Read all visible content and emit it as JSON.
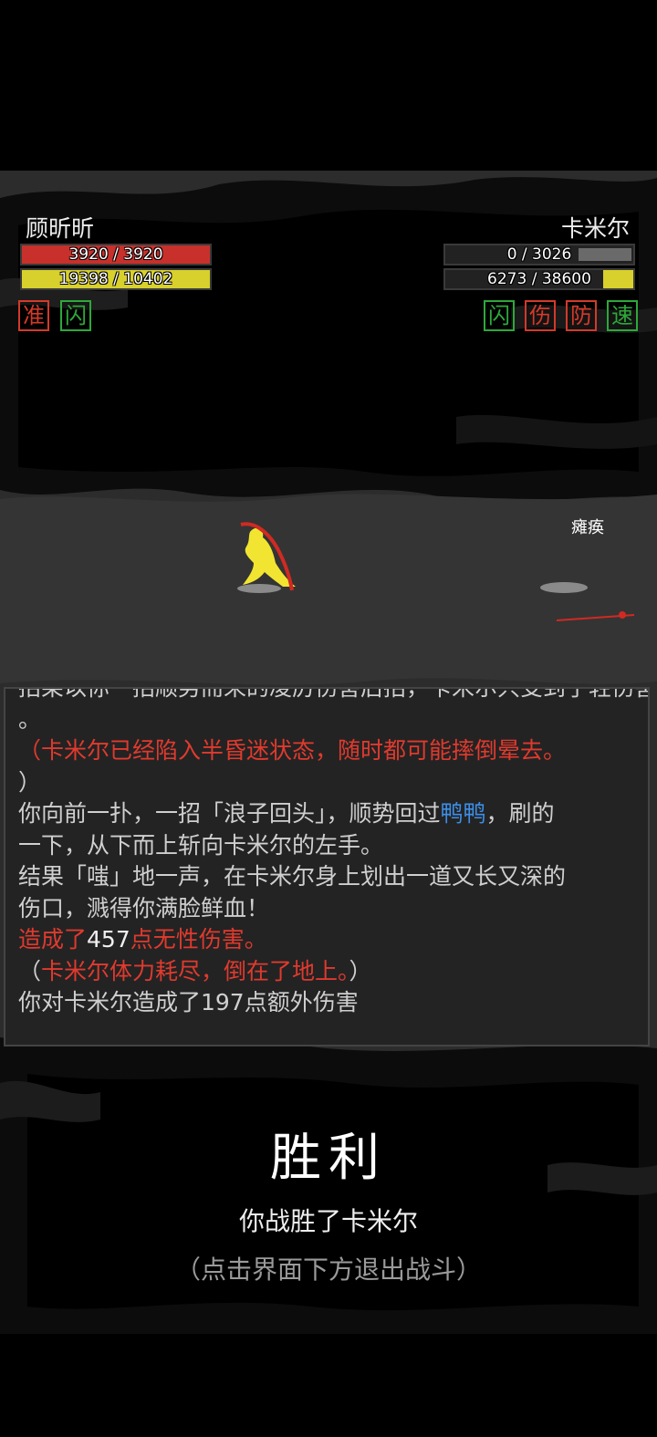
{
  "player": {
    "name": "顾昕昕",
    "hp": "3920 / 3920",
    "hp_ratio": 1.0,
    "energy": "19398 / 10402",
    "energy_ratio": 1.0,
    "status_badges": [
      {
        "label": "准",
        "color": "#d23a2a"
      },
      {
        "label": "闪",
        "color": "#2ea83a"
      }
    ]
  },
  "enemy": {
    "name": "卡米尔",
    "hp": "0 / 3026",
    "hp_ratio": 0.0,
    "energy": "6273 / 38600",
    "energy_ratio": 0.16,
    "status_badges": [
      {
        "label": "闪",
        "color": "#2ea83a"
      },
      {
        "label": "伤",
        "color": "#d23a2a"
      },
      {
        "label": "防",
        "color": "#d23a2a"
      },
      {
        "label": "速",
        "color": "#2ea83a"
      }
    ],
    "status_tag": "瘫痪"
  },
  "colors": {
    "hp_bar": "#c8302c",
    "energy_bar": "#d8d02c",
    "enemy_hp_bar": "#6a6a6a",
    "log_red": "#e03a2e",
    "log_blue": "#3d8fe8"
  },
  "battle_log": {
    "l0": "招架以你一招顺势而来的凌厉伤害后招，卡米尔只受到了轻伤害",
    "l1": "。",
    "l2a": "（",
    "l2b": "卡米尔已经陷入半昏迷状态，随时都可能摔倒晕去。",
    "l3": "）",
    "l4a": "你向前一扑，一招「浪子回头」，顺势回过",
    "l4b": "鸭鸭",
    "l4c": "，刷的",
    "l5": "一下，从下而上斩向卡米尔的左手。",
    "l6": "结果「嗤」地一声，在卡米尔身上划出一道又长又深的",
    "l7": "伤口，溅得你满脸鲜血！",
    "l8a": "造成了",
    "l8b": "457",
    "l8c": "点无性伤害。",
    "l9a": "（",
    "l9b": "卡米尔体力耗尽，倒在了地上。",
    "l9c": "）",
    "l10": "你对卡米尔造成了197点额外伤害"
  },
  "result": {
    "title": "胜利",
    "subtitle": "你战胜了卡米尔",
    "hint": "（点击界面下方退出战斗）"
  }
}
